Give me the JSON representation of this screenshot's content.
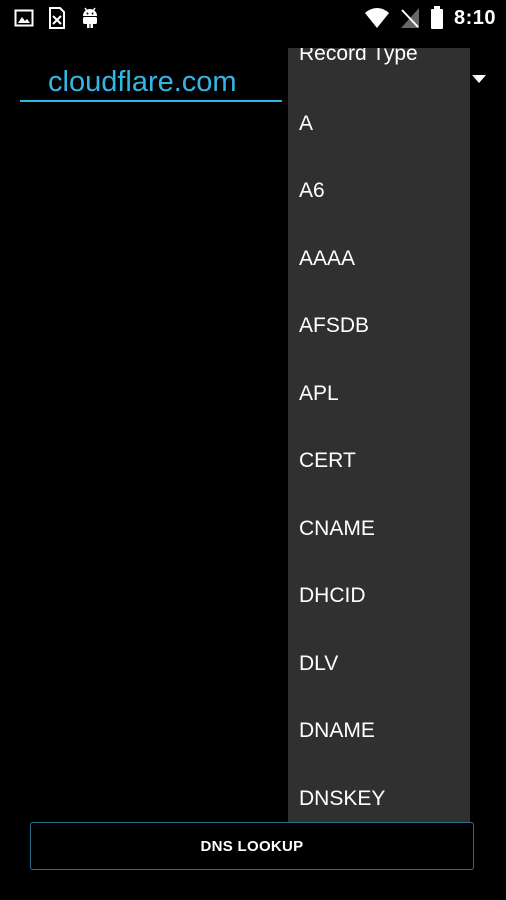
{
  "status_bar": {
    "time": "8:10",
    "left_icons": [
      "image-icon",
      "sim-card-icon",
      "android-icon"
    ],
    "right_icons": [
      "wifi-icon",
      "no-signal-icon",
      "battery-icon"
    ]
  },
  "domain_field": {
    "value": "cloudflare.com"
  },
  "record_type_dropdown": {
    "header": "Record Type",
    "options": [
      "A",
      "A6",
      "AAAA",
      "AFSDB",
      "APL",
      "CERT",
      "CNAME",
      "DHCID",
      "DLV",
      "DNAME",
      "DNSKEY"
    ]
  },
  "lookup_button": {
    "label": "DNS LOOKUP"
  },
  "colors": {
    "accent": "#33b5e5",
    "dropdown_bg": "#303030",
    "button_border": "#2b6f86"
  }
}
